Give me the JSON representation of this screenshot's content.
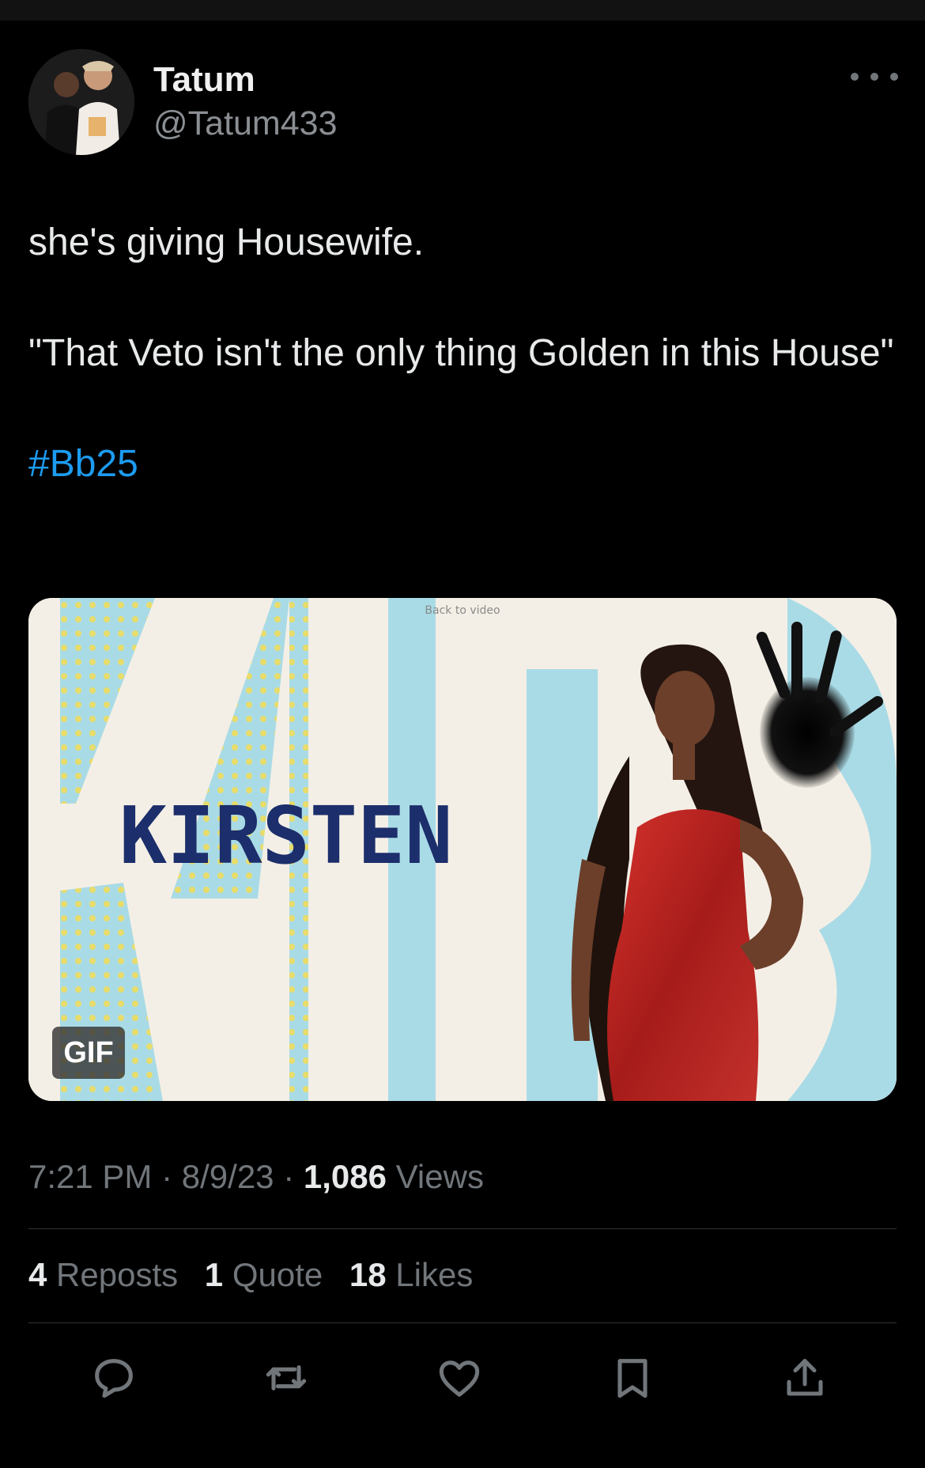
{
  "user": {
    "name": "Tatum",
    "handle": "@Tatum433"
  },
  "tweet": {
    "line1": "she's giving Housewife.",
    "line2": "\"That Veto isn't the only thing Golden in this House\"",
    "hashtag": "#Bb25"
  },
  "media": {
    "badge": "GIF",
    "caption_top": "Back to video",
    "overlay_name": "KIRSTEN"
  },
  "meta": {
    "time": "7:21 PM",
    "date": "8/9/23",
    "views_count": "1,086",
    "views_label": "Views",
    "separator": "·"
  },
  "stats": {
    "reposts_count": "4",
    "reposts_label": "Reposts",
    "quotes_count": "1",
    "quotes_label": "Quote",
    "likes_count": "18",
    "likes_label": "Likes"
  },
  "actions": [
    "reply-icon",
    "repost-icon",
    "like-icon",
    "bookmark-icon",
    "share-icon"
  ],
  "colors": {
    "background": "#000000",
    "text": "#e7e9ea",
    "secondary": "#71767b",
    "link": "#1d9bf0",
    "divider": "#2f3336"
  }
}
